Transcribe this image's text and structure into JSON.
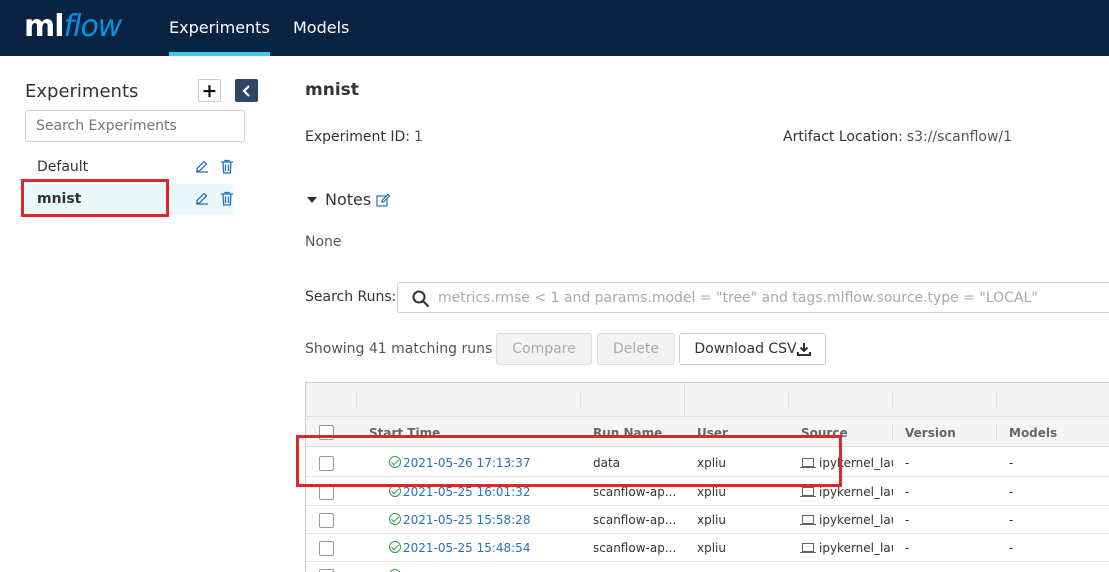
{
  "header": {
    "logo_ml": "ml",
    "logo_flow": "flow",
    "nav": [
      {
        "label": "Experiments",
        "active": true
      },
      {
        "label": "Models",
        "active": false
      }
    ],
    "colors": {
      "bar": "#0a2342",
      "accent": "#43c9ed"
    }
  },
  "sidebar": {
    "title": "Experiments",
    "add_icon": "plus-icon",
    "collapse_icon": "chevron-left-icon",
    "search_placeholder": "Search Experiments",
    "experiments": [
      {
        "name": "Default",
        "active": false
      },
      {
        "name": "mnist",
        "active": true
      }
    ]
  },
  "main": {
    "experiment_name": "mnist",
    "experiment_id_label": "Experiment ID",
    "experiment_id": "1",
    "artifact_label": "Artifact Location",
    "artifact_value": "s3://scanflow/1",
    "notes_label": "Notes",
    "notes_value": "None",
    "search_runs_label": "Search Runs:",
    "search_runs_placeholder": "metrics.rmse < 1 and params.model = \"tree\" and tags.mlflow.source.type = \"LOCAL\"",
    "showing_text": "Showing 41 matching runs",
    "buttons": {
      "compare": "Compare",
      "delete": "Delete",
      "download": "Download CSV"
    }
  },
  "table": {
    "columns": [
      "Start Time",
      "Run Name",
      "User",
      "Source",
      "Version",
      "Models"
    ],
    "rows": [
      {
        "start_time": "2021-05-26 17:13:37",
        "run_name": "data",
        "user": "xpliu",
        "source": "ipykernel_lau",
        "version": "-",
        "models": "-"
      },
      {
        "start_time": "2021-05-25 16:01:32",
        "run_name": "scanflow-ap...",
        "user": "xpliu",
        "source": "ipykernel_lau",
        "version": "-",
        "models": "-"
      },
      {
        "start_time": "2021-05-25 15:58:28",
        "run_name": "scanflow-ap...",
        "user": "xpliu",
        "source": "ipykernel_lau",
        "version": "-",
        "models": "-"
      },
      {
        "start_time": "2021-05-25 15:48:54",
        "run_name": "scanflow-ap...",
        "user": "xpliu",
        "source": "ipykernel_lau",
        "version": "-",
        "models": "-"
      }
    ]
  }
}
